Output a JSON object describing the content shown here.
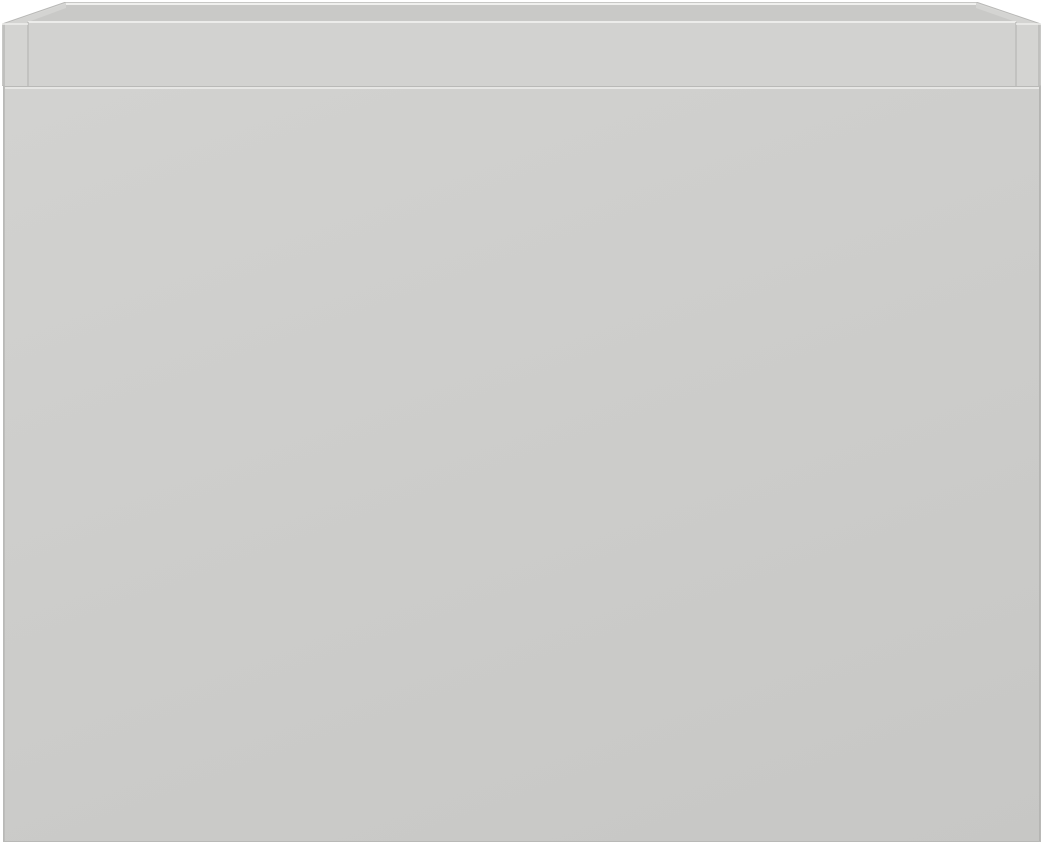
{
  "object": {
    "kind": "cabinet-drawer-box",
    "colors": {
      "panel": "#cdcdcb",
      "rim": "#d9d9d7",
      "inner_shadow": "#b9b9b7",
      "highlight": "#f2f2f0"
    }
  }
}
